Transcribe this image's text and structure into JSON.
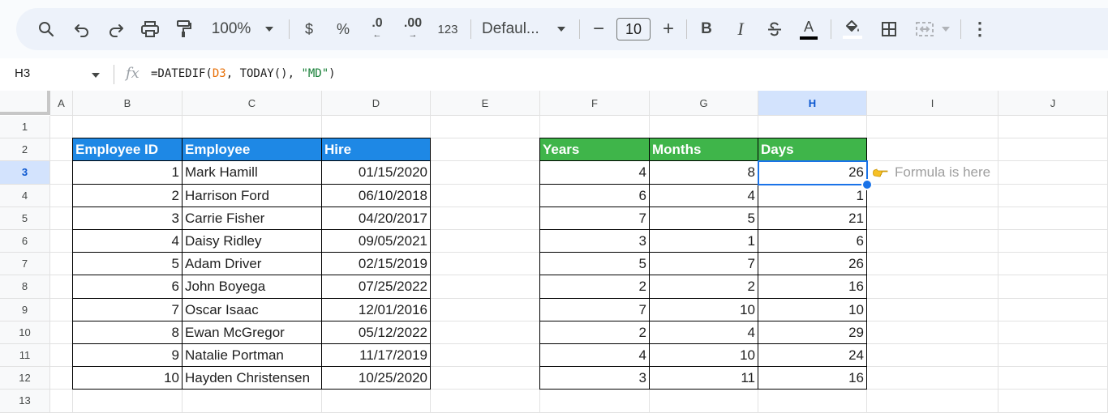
{
  "toolbar": {
    "zoom": "100%",
    "currency": "$",
    "percent": "%",
    "decrease_decimal": ".0",
    "increase_decimal": ".00",
    "more_formats": "123",
    "font": "Defaul...",
    "font_size": "10",
    "minus": "−",
    "plus": "+",
    "bold": "B",
    "italic": "I",
    "text_color_letter": "A",
    "more": "⋮"
  },
  "formula_bar": {
    "cell_ref": "H3",
    "fx": "fx",
    "formula_prefix": "=DATEDIF(",
    "formula_ref": "D3",
    "formula_middle": ", TODAY(), ",
    "formula_string": "\"MD\"",
    "formula_suffix": ")"
  },
  "grid": {
    "columns": [
      "A",
      "B",
      "C",
      "D",
      "E",
      "F",
      "G",
      "H",
      "I",
      "J"
    ],
    "rows": [
      "1",
      "2",
      "3",
      "4",
      "5",
      "6",
      "7",
      "8",
      "9",
      "10",
      "11",
      "12",
      "13"
    ],
    "selected_column": "H",
    "selected_row": "3",
    "header_colors": {
      "blue": "#1e88e5",
      "green": "#3fb54a",
      "selection": "#1a73e8"
    },
    "employees_table": {
      "headers": [
        "Employee ID",
        "Employee",
        "Hire"
      ],
      "rows": [
        [
          "1",
          "Mark Hamill",
          "01/15/2020"
        ],
        [
          "2",
          "Harrison Ford",
          "06/10/2018"
        ],
        [
          "3",
          "Carrie Fisher",
          "04/20/2017"
        ],
        [
          "4",
          "Daisy Ridley",
          "09/05/2021"
        ],
        [
          "5",
          "Adam Driver",
          "02/15/2019"
        ],
        [
          "6",
          "John Boyega",
          "07/25/2022"
        ],
        [
          "7",
          "Oscar Isaac",
          "12/01/2016"
        ],
        [
          "8",
          "Ewan McGregor",
          "05/12/2022"
        ],
        [
          "9",
          "Natalie Portman",
          "11/17/2019"
        ],
        [
          "10",
          "Hayden Christensen",
          "10/25/2020"
        ]
      ]
    },
    "duration_table": {
      "headers": [
        "Years",
        "Months",
        "Days"
      ],
      "rows": [
        [
          "4",
          "8",
          "26"
        ],
        [
          "6",
          "4",
          "1"
        ],
        [
          "7",
          "5",
          "21"
        ],
        [
          "3",
          "1",
          "6"
        ],
        [
          "5",
          "7",
          "26"
        ],
        [
          "2",
          "2",
          "16"
        ],
        [
          "7",
          "10",
          "10"
        ],
        [
          "2",
          "4",
          "29"
        ],
        [
          "4",
          "10",
          "24"
        ],
        [
          "3",
          "11",
          "16"
        ]
      ]
    },
    "note": "Formula is here",
    "note_icon": "pointing-hand-icon"
  }
}
